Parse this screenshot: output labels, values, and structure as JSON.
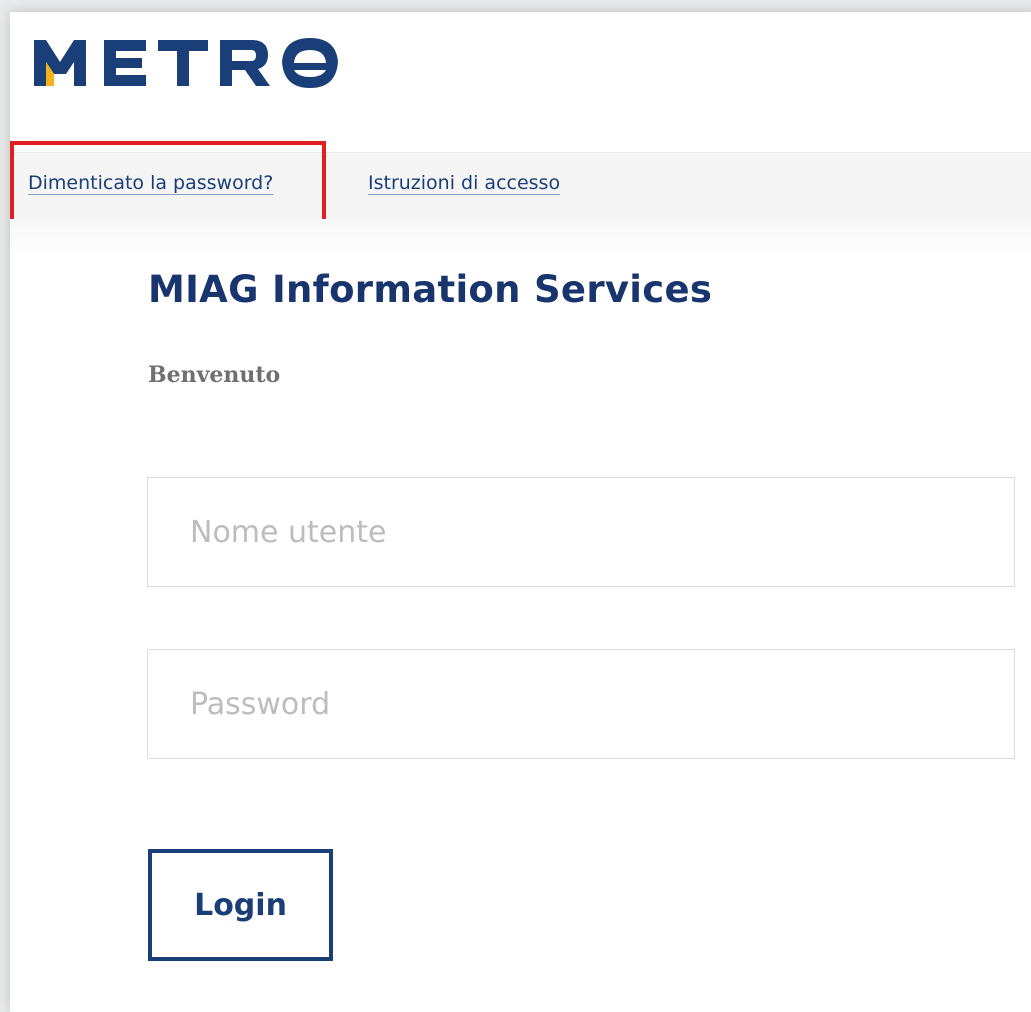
{
  "brand": {
    "logo_text": "METRO",
    "colors": {
      "primary": "#1a3e78",
      "accent": "#f5b21b",
      "highlight": "#e02020"
    }
  },
  "nav": {
    "forgot_password": "Dimenticato la password?",
    "access_instructions": "Istruzioni di accesso"
  },
  "main": {
    "title": "MIAG Information Services",
    "welcome": "Benvenuto"
  },
  "form": {
    "username": {
      "value": "",
      "placeholder": "Nome utente"
    },
    "password": {
      "value": "",
      "placeholder": "Password"
    },
    "login_label": "Login"
  }
}
